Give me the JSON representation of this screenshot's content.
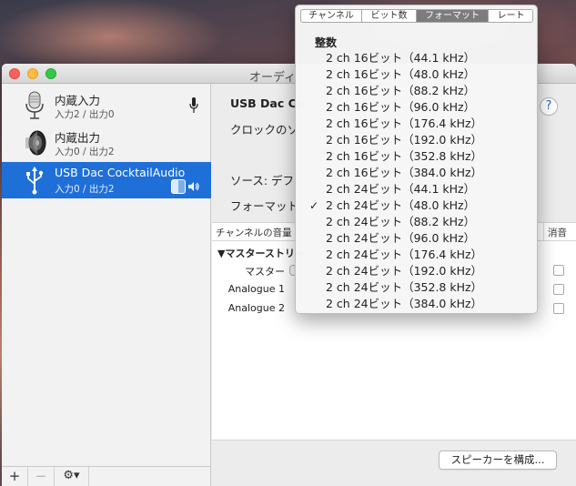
{
  "window": {
    "title": "オーディ"
  },
  "sidebar": {
    "devices": [
      {
        "name": "内蔵入力",
        "io": "入力2 / 出力0"
      },
      {
        "name": "内蔵出力",
        "io": "入力0 / 出力2"
      },
      {
        "name": "USB Dac CocktailAudio",
        "io": "入力0 / 出力2",
        "selected": true
      }
    ],
    "add_label": "+",
    "remove_label": "−",
    "gear_label": "⚙▾"
  },
  "main": {
    "device_title": "USB Dac Co",
    "clock_label": "クロックのソ",
    "help_label": "?",
    "source_label": "ソース:  デフ",
    "format_label": "フォーマット",
    "table": {
      "channel_header": "チャンネルの音量",
      "mute_header": "消音",
      "group": "▼マスターストリー",
      "channels": [
        "マスター",
        "Analogue 1",
        "Analogue 2"
      ]
    },
    "configure_button": "スピーカーを構成..."
  },
  "popup": {
    "segments": [
      {
        "label": "チャンネル",
        "active": false
      },
      {
        "label": "ビット数",
        "active": false
      },
      {
        "label": "フォーマット",
        "active": true
      },
      {
        "label": "レート",
        "active": false
      }
    ],
    "header": "整数",
    "items": [
      {
        "label": "2 ch 16ビット（44.1 kHz）",
        "checked": false
      },
      {
        "label": "2 ch 16ビット（48.0 kHz）",
        "checked": false
      },
      {
        "label": "2 ch 16ビット（88.2 kHz）",
        "checked": false
      },
      {
        "label": "2 ch 16ビット（96.0 kHz）",
        "checked": false
      },
      {
        "label": "2 ch 16ビット（176.4 kHz）",
        "checked": false
      },
      {
        "label": "2 ch 16ビット（192.0 kHz）",
        "checked": false
      },
      {
        "label": "2 ch 16ビット（352.8 kHz）",
        "checked": false
      },
      {
        "label": "2 ch 16ビット（384.0 kHz）",
        "checked": false
      },
      {
        "label": "2 ch 24ビット（44.1 kHz）",
        "checked": false
      },
      {
        "label": "2 ch 24ビット（48.0 kHz）",
        "checked": true
      },
      {
        "label": "2 ch 24ビット（88.2 kHz）",
        "checked": false
      },
      {
        "label": "2 ch 24ビット（96.0 kHz）",
        "checked": false
      },
      {
        "label": "2 ch 24ビット（176.4 kHz）",
        "checked": false
      },
      {
        "label": "2 ch 24ビット（192.0 kHz）",
        "checked": false
      },
      {
        "label": "2 ch 24ビット（352.8 kHz）",
        "checked": false
      },
      {
        "label": "2 ch 24ビット（384.0 kHz）",
        "checked": false
      }
    ],
    "check_mark": "✓"
  },
  "colors": {
    "selection": "#1f6fd9",
    "segment_active": "#7c7c7c"
  }
}
